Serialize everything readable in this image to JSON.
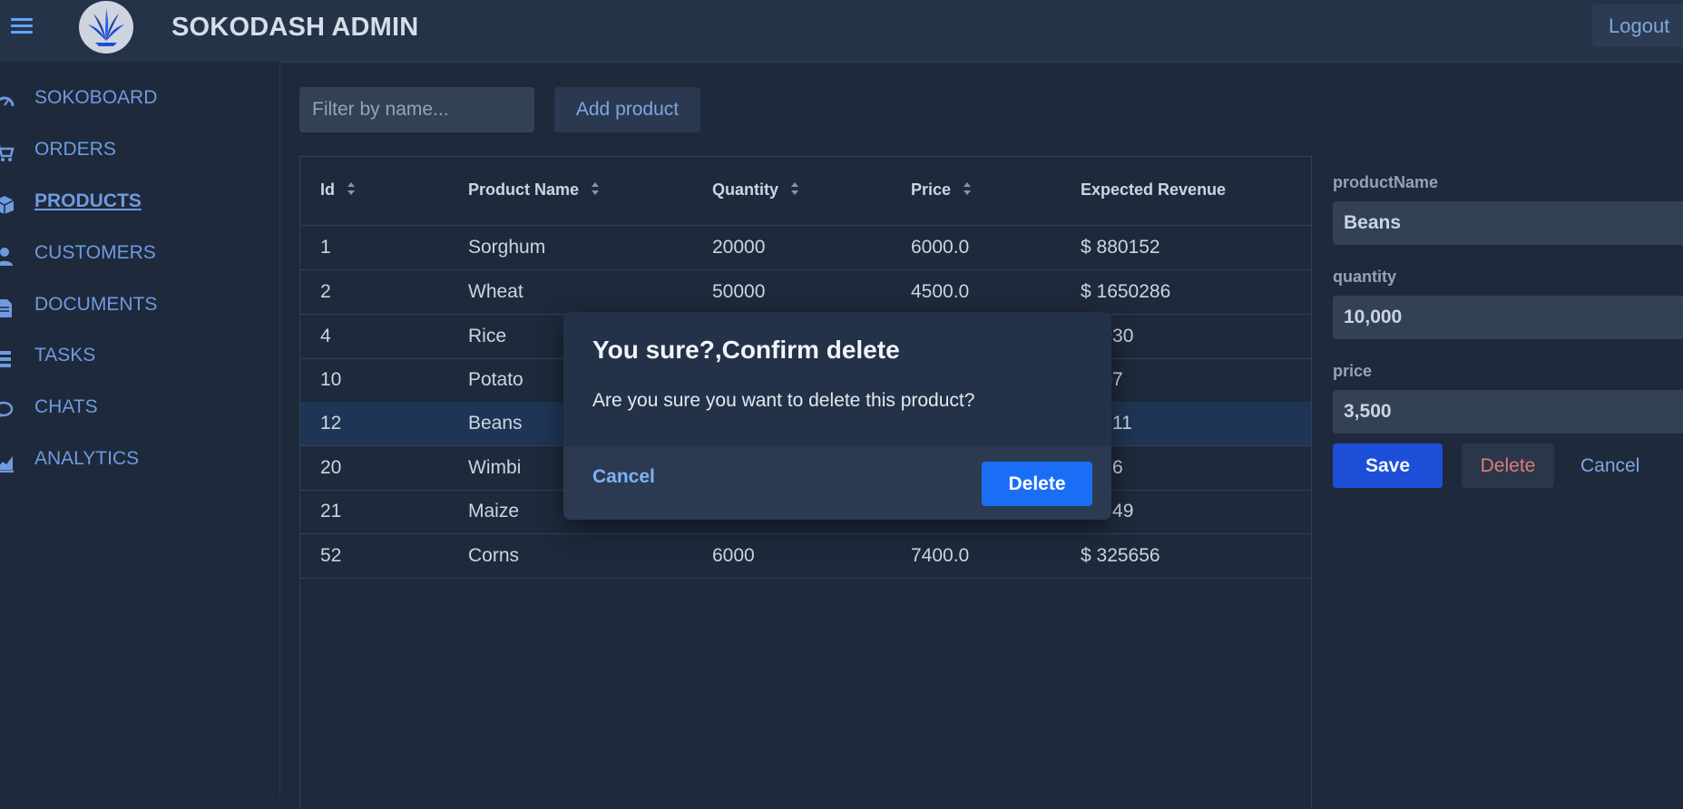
{
  "header": {
    "brand": "SOKODASH ADMIN",
    "logout_label": "Logout"
  },
  "sidebar": {
    "items": [
      {
        "label": "SOKOBOARD",
        "icon": "dashboard-icon"
      },
      {
        "label": "ORDERS",
        "icon": "cart-icon"
      },
      {
        "label": "PRODUCTS",
        "icon": "box-icon",
        "active": true
      },
      {
        "label": "CUSTOMERS",
        "icon": "user-icon"
      },
      {
        "label": "DOCUMENTS",
        "icon": "document-icon"
      },
      {
        "label": "TASKS",
        "icon": "list-icon"
      },
      {
        "label": "CHATS",
        "icon": "chat-icon"
      },
      {
        "label": "ANALYTICS",
        "icon": "chart-icon"
      }
    ]
  },
  "toolbar": {
    "filter_placeholder": "Filter by name...",
    "add_label": "Add product"
  },
  "table": {
    "headers": [
      "Id",
      "Product Name",
      "Quantity",
      "Price",
      "Expected Revenue"
    ],
    "rows": [
      {
        "id": "1",
        "name": "Sorghum",
        "qty": "20000",
        "price": "6000.0",
        "rev": "$ 880152"
      },
      {
        "id": "2",
        "name": "Wheat",
        "qty": "50000",
        "price": "4500.0",
        "rev": "$ 1650286"
      },
      {
        "id": "4",
        "name": "Rice",
        "qty": "",
        "price": "",
        "rev": "76030"
      },
      {
        "id": "10",
        "name": "Potato",
        "qty": "",
        "price": "",
        "rev": "4007"
      },
      {
        "id": "12",
        "name": "Beans",
        "qty": "",
        "price": "",
        "rev": "56711"
      },
      {
        "id": "20",
        "name": "Wimbi",
        "qty": "",
        "price": "",
        "rev": "3676"
      },
      {
        "id": "21",
        "name": "Maize",
        "qty": "",
        "price": "",
        "rev": "76749"
      },
      {
        "id": "52",
        "name": "Corns",
        "qty": "6000",
        "price": "7400.0",
        "rev": "$ 325656"
      }
    ]
  },
  "form": {
    "name_label": "productName",
    "name_value": "Beans",
    "qty_label": "quantity",
    "qty_value": "10,000",
    "price_label": "price",
    "price_value": "3,500",
    "save_label": "Save",
    "delete_label": "Delete",
    "cancel_label": "Cancel"
  },
  "modal": {
    "title": "You sure?,Confirm delete",
    "body": "Are you sure you want to delete this product?",
    "cancel_label": "Cancel",
    "delete_label": "Delete"
  }
}
